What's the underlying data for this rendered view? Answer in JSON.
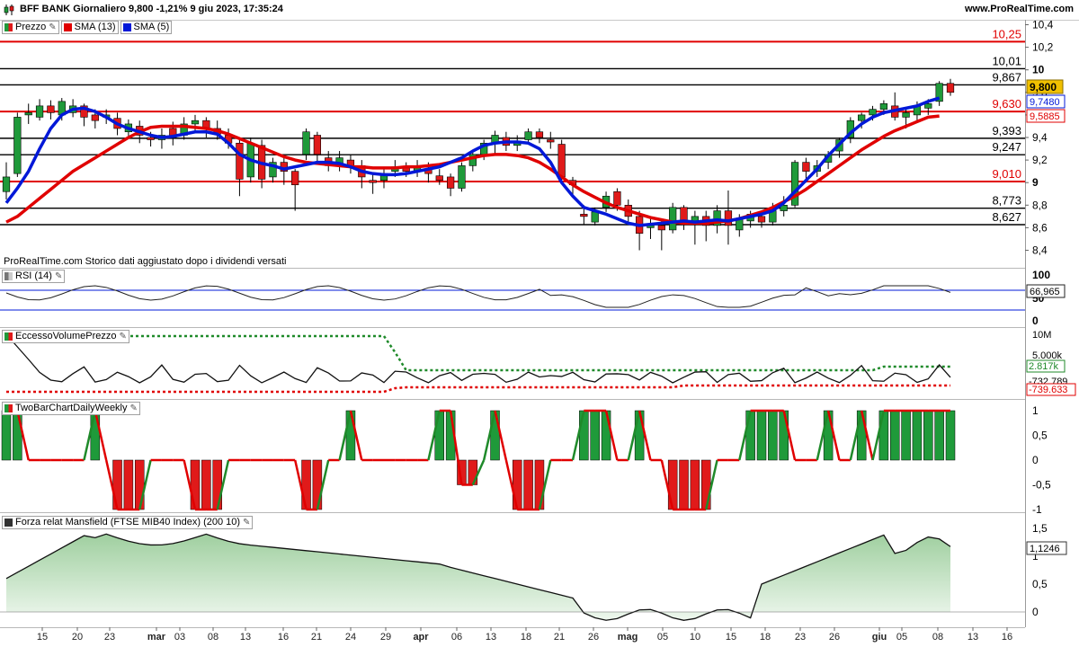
{
  "header": {
    "title": "BFF BANK Giornaliero 9,800 -1,21% 9 giu 2023, 17:35:24",
    "site": "www.ProRealTime.com"
  },
  "price_panel": {
    "legend": {
      "price": "Prezzo",
      "sma13": "SMA (13)",
      "sma5": "SMA (5)"
    },
    "note": "ProRealTime.com  Storico dati aggiustato dopo i dividendi versati",
    "y_ticks": [
      "10,4",
      "10,2",
      "10",
      "9,8",
      "9,6",
      "9,4",
      "9,2",
      "9",
      "8,8",
      "8,6",
      "8,4"
    ],
    "levels": [
      {
        "value": 10.25,
        "label": "10,25",
        "color": "#e00000"
      },
      {
        "value": 10.01,
        "label": "10,01",
        "color": "#000000"
      },
      {
        "value": 9.867,
        "label": "9,867",
        "color": "#000000"
      },
      {
        "value": 9.63,
        "label": "9,630",
        "color": "#e00000"
      },
      {
        "value": 9.393,
        "label": "9,393",
        "color": "#000000"
      },
      {
        "value": 9.247,
        "label": "9,247",
        "color": "#000000"
      },
      {
        "value": 9.01,
        "label": "9,010",
        "color": "#e00000"
      },
      {
        "value": 8.773,
        "label": "8,773",
        "color": "#000000"
      },
      {
        "value": 8.627,
        "label": "8,627",
        "color": "#000000"
      }
    ],
    "last_price": "9,800",
    "sma5_value": "9,7480",
    "sma13_value": "9,5885"
  },
  "rsi_panel": {
    "legend": "RSI (14)",
    "ticks": [
      "100",
      "50",
      "0"
    ],
    "value": "66,965"
  },
  "evp_panel": {
    "legend": "EccessoVolumePrezzo",
    "ticks": [
      "10M",
      "5.000k"
    ],
    "upper": "2.817k",
    "mid": "-732.789",
    "lower": "-739.633"
  },
  "twobar_panel": {
    "legend": "TwoBarChartDailyWeekly",
    "ticks": [
      "1",
      "0,5",
      "0",
      "-0,5",
      "-1"
    ]
  },
  "mansfield_panel": {
    "legend": "Forza relat Mansfield (FTSE MIB40 Index) (200 10)",
    "ticks": [
      "1,5",
      "1",
      "0,5",
      "0"
    ],
    "value": "1,1246"
  },
  "x_axis": {
    "labels": [
      "15",
      "20",
      "23",
      "mar",
      "03",
      "08",
      "13",
      "16",
      "21",
      "24",
      "29",
      "apr",
      "06",
      "13",
      "18",
      "21",
      "26",
      "mag",
      "05",
      "10",
      "15",
      "18",
      "23",
      "26",
      "giu",
      "05",
      "08",
      "13",
      "16"
    ]
  },
  "colors": {
    "up": "#1f9a3a",
    "down": "#e01a1a",
    "sma5": "#0018d8",
    "sma13": "#e00000",
    "last_bg": "#f0c000"
  },
  "chart_data": {
    "type": "candlestick",
    "title": "BFF BANK Giornaliero",
    "candles": [
      {
        "o": 8.92,
        "c": 9.05,
        "h": 9.18,
        "l": 8.85
      },
      {
        "o": 9.08,
        "c": 9.58,
        "h": 9.62,
        "l": 9.05
      },
      {
        "o": 9.6,
        "c": 9.62,
        "h": 9.7,
        "l": 9.52
      },
      {
        "o": 9.58,
        "c": 9.68,
        "h": 9.74,
        "l": 9.55
      },
      {
        "o": 9.68,
        "c": 9.62,
        "h": 9.73,
        "l": 9.56
      },
      {
        "o": 9.6,
        "c": 9.72,
        "h": 9.75,
        "l": 9.55
      },
      {
        "o": 9.62,
        "c": 9.68,
        "h": 9.74,
        "l": 9.58
      },
      {
        "o": 9.68,
        "c": 9.58,
        "h": 9.7,
        "l": 9.5
      },
      {
        "o": 9.6,
        "c": 9.55,
        "h": 9.65,
        "l": 9.48
      },
      {
        "o": 9.58,
        "c": 9.6,
        "h": 9.65,
        "l": 9.52
      },
      {
        "o": 9.57,
        "c": 9.48,
        "h": 9.62,
        "l": 9.42
      },
      {
        "o": 9.45,
        "c": 9.52,
        "h": 9.56,
        "l": 9.4
      },
      {
        "o": 9.5,
        "c": 9.42,
        "h": 9.55,
        "l": 9.35
      },
      {
        "o": 9.4,
        "c": 9.38,
        "h": 9.45,
        "l": 9.32
      },
      {
        "o": 9.38,
        "c": 9.42,
        "h": 9.48,
        "l": 9.3
      },
      {
        "o": 9.48,
        "c": 9.4,
        "h": 9.54,
        "l": 9.33
      },
      {
        "o": 9.42,
        "c": 9.52,
        "h": 9.58,
        "l": 9.38
      },
      {
        "o": 9.52,
        "c": 9.55,
        "h": 9.6,
        "l": 9.45
      },
      {
        "o": 9.55,
        "c": 9.48,
        "h": 9.58,
        "l": 9.4
      },
      {
        "o": 9.48,
        "c": 9.43,
        "h": 9.55,
        "l": 9.38
      },
      {
        "o": 9.42,
        "c": 9.35,
        "h": 9.48,
        "l": 9.3
      },
      {
        "o": 9.35,
        "c": 9.03,
        "h": 9.4,
        "l": 8.88
      },
      {
        "o": 9.05,
        "c": 9.35,
        "h": 9.4,
        "l": 9.0
      },
      {
        "o": 9.33,
        "c": 9.03,
        "h": 9.38,
        "l": 8.95
      },
      {
        "o": 9.05,
        "c": 9.18,
        "h": 9.22,
        "l": 9.0
      },
      {
        "o": 9.18,
        "c": 9.1,
        "h": 9.22,
        "l": 8.98
      },
      {
        "o": 9.1,
        "c": 8.98,
        "h": 9.12,
        "l": 8.75
      },
      {
        "o": 9.25,
        "c": 9.45,
        "h": 9.48,
        "l": 9.2
      },
      {
        "o": 9.42,
        "c": 9.25,
        "h": 9.45,
        "l": 9.18
      },
      {
        "o": 9.22,
        "c": 9.15,
        "h": 9.28,
        "l": 9.1
      },
      {
        "o": 9.15,
        "c": 9.22,
        "h": 9.28,
        "l": 9.1
      },
      {
        "o": 9.2,
        "c": 9.15,
        "h": 9.25,
        "l": 9.08
      },
      {
        "o": 9.15,
        "c": 9.05,
        "h": 9.2,
        "l": 8.95
      },
      {
        "o": 9.02,
        "c": 9.0,
        "h": 9.08,
        "l": 8.9
      },
      {
        "o": 9.02,
        "c": 9.08,
        "h": 9.12,
        "l": 8.95
      },
      {
        "o": 9.1,
        "c": 9.14,
        "h": 9.2,
        "l": 9.05
      },
      {
        "o": 9.13,
        "c": 9.1,
        "h": 9.18,
        "l": 9.05
      },
      {
        "o": 9.1,
        "c": 9.15,
        "h": 9.2,
        "l": 9.05
      },
      {
        "o": 9.12,
        "c": 9.08,
        "h": 9.18,
        "l": 9.0
      },
      {
        "o": 9.06,
        "c": 9.02,
        "h": 9.12,
        "l": 8.98
      },
      {
        "o": 9.05,
        "c": 8.95,
        "h": 9.08,
        "l": 8.88
      },
      {
        "o": 8.95,
        "c": 9.15,
        "h": 9.18,
        "l": 8.92
      },
      {
        "o": 9.15,
        "c": 9.25,
        "h": 9.28,
        "l": 9.1
      },
      {
        "o": 9.25,
        "c": 9.35,
        "h": 9.38,
        "l": 9.2
      },
      {
        "o": 9.35,
        "c": 9.42,
        "h": 9.46,
        "l": 9.25
      },
      {
        "o": 9.4,
        "c": 9.33,
        "h": 9.45,
        "l": 9.28
      },
      {
        "o": 9.33,
        "c": 9.37,
        "h": 9.42,
        "l": 9.28
      },
      {
        "o": 9.38,
        "c": 9.45,
        "h": 9.48,
        "l": 9.35
      },
      {
        "o": 9.45,
        "c": 9.4,
        "h": 9.48,
        "l": 9.35
      },
      {
        "o": 9.38,
        "c": 9.36,
        "h": 9.45,
        "l": 9.3
      },
      {
        "o": 9.34,
        "c": 9.05,
        "h": 9.38,
        "l": 9.0
      },
      {
        "o": 9.02,
        "c": 8.98,
        "h": 9.05,
        "l": 8.88
      },
      {
        "o": 8.72,
        "c": 8.7,
        "h": 8.8,
        "l": 8.63
      },
      {
        "o": 8.65,
        "c": 8.74,
        "h": 8.78,
        "l": 8.62
      },
      {
        "o": 8.78,
        "c": 8.88,
        "h": 8.92,
        "l": 8.74
      },
      {
        "o": 8.92,
        "c": 8.8,
        "h": 8.95,
        "l": 8.75
      },
      {
        "o": 8.8,
        "c": 8.7,
        "h": 8.85,
        "l": 8.65
      },
      {
        "o": 8.7,
        "c": 8.55,
        "h": 8.75,
        "l": 8.4
      },
      {
        "o": 8.6,
        "c": 8.62,
        "h": 8.68,
        "l": 8.5
      },
      {
        "o": 8.62,
        "c": 8.58,
        "h": 8.66,
        "l": 8.4
      },
      {
        "o": 8.58,
        "c": 8.78,
        "h": 8.82,
        "l": 8.55
      },
      {
        "o": 8.78,
        "c": 8.65,
        "h": 8.8,
        "l": 8.58
      },
      {
        "o": 8.65,
        "c": 8.7,
        "h": 8.75,
        "l": 8.45
      },
      {
        "o": 8.7,
        "c": 8.62,
        "h": 8.75,
        "l": 8.48
      },
      {
        "o": 8.62,
        "c": 8.75,
        "h": 8.8,
        "l": 8.55
      },
      {
        "o": 8.75,
        "c": 8.62,
        "h": 8.93,
        "l": 8.45
      },
      {
        "o": 8.58,
        "c": 8.68,
        "h": 8.72,
        "l": 8.52
      },
      {
        "o": 8.66,
        "c": 8.72,
        "h": 8.75,
        "l": 8.6
      },
      {
        "o": 8.7,
        "c": 8.65,
        "h": 8.75,
        "l": 8.6
      },
      {
        "o": 8.65,
        "c": 8.75,
        "h": 8.82,
        "l": 8.62
      },
      {
        "o": 8.75,
        "c": 8.8,
        "h": 8.88,
        "l": 8.7
      },
      {
        "o": 8.8,
        "c": 9.18,
        "h": 9.2,
        "l": 8.78
      },
      {
        "o": 9.18,
        "c": 9.1,
        "h": 9.22,
        "l": 9.0
      },
      {
        "o": 9.1,
        "c": 9.15,
        "h": 9.2,
        "l": 9.05
      },
      {
        "o": 9.18,
        "c": 9.25,
        "h": 9.28,
        "l": 9.12
      },
      {
        "o": 9.28,
        "c": 9.38,
        "h": 9.4,
        "l": 9.22
      },
      {
        "o": 9.4,
        "c": 9.55,
        "h": 9.58,
        "l": 9.35
      },
      {
        "o": 9.55,
        "c": 9.6,
        "h": 9.62,
        "l": 9.48
      },
      {
        "o": 9.6,
        "c": 9.65,
        "h": 9.68,
        "l": 9.55
      },
      {
        "o": 9.65,
        "c": 9.7,
        "h": 9.73,
        "l": 9.6
      },
      {
        "o": 9.68,
        "c": 9.58,
        "h": 9.8,
        "l": 9.55
      },
      {
        "o": 9.58,
        "c": 9.62,
        "h": 9.66,
        "l": 9.48
      },
      {
        "o": 9.6,
        "c": 9.68,
        "h": 9.72,
        "l": 9.55
      },
      {
        "o": 9.66,
        "c": 9.7,
        "h": 9.74,
        "l": 9.6
      },
      {
        "o": 9.72,
        "c": 9.88,
        "h": 9.9,
        "l": 9.68
      },
      {
        "o": 9.88,
        "c": 9.8,
        "h": 9.92,
        "l": 9.77
      }
    ],
    "sma5": [
      8.82,
      8.95,
      9.1,
      9.3,
      9.48,
      9.6,
      9.65,
      9.66,
      9.63,
      9.58,
      9.52,
      9.48,
      9.45,
      9.42,
      9.4,
      9.41,
      9.43,
      9.45,
      9.45,
      9.43,
      9.35,
      9.25,
      9.2,
      9.17,
      9.15,
      9.12,
      9.14,
      9.16,
      9.18,
      9.18,
      9.17,
      9.14,
      9.1,
      9.08,
      9.07,
      9.07,
      9.08,
      9.1,
      9.12,
      9.14,
      9.18,
      9.22,
      9.28,
      9.33,
      9.35,
      9.36,
      9.36,
      9.35,
      9.3,
      9.18,
      9.0,
      8.88,
      8.78,
      8.75,
      8.72,
      8.68,
      8.64,
      8.62,
      8.63,
      8.64,
      8.65,
      8.66,
      8.65,
      8.66,
      8.67,
      8.66,
      8.68,
      8.7,
      8.72,
      8.75,
      8.82,
      8.92,
      9.02,
      9.12,
      9.24,
      9.34,
      9.44,
      9.52,
      9.58,
      9.62,
      9.64,
      9.66,
      9.68,
      9.72,
      9.75
    ],
    "sma13": [
      8.65,
      8.7,
      8.78,
      8.86,
      8.94,
      9.02,
      9.1,
      9.16,
      9.22,
      9.28,
      9.34,
      9.4,
      9.45,
      9.49,
      9.5,
      9.5,
      9.5,
      9.49,
      9.48,
      9.46,
      9.43,
      9.39,
      9.35,
      9.31,
      9.27,
      9.23,
      9.2,
      9.18,
      9.17,
      9.16,
      9.15,
      9.14,
      9.14,
      9.13,
      9.13,
      9.13,
      9.14,
      9.14,
      9.15,
      9.16,
      9.18,
      9.2,
      9.22,
      9.24,
      9.25,
      9.25,
      9.24,
      9.22,
      9.18,
      9.12,
      9.05,
      8.98,
      8.92,
      8.87,
      8.82,
      8.78,
      8.75,
      8.72,
      8.69,
      8.67,
      8.65,
      8.64,
      8.64,
      8.64,
      8.65,
      8.66,
      8.68,
      8.71,
      8.74,
      8.78,
      8.83,
      8.88,
      8.94,
      9.01,
      9.08,
      9.15,
      9.22,
      9.29,
      9.35,
      9.41,
      9.46,
      9.5,
      9.54,
      9.58,
      9.59
    ],
    "ylim": [
      8.3,
      10.45
    ]
  }
}
